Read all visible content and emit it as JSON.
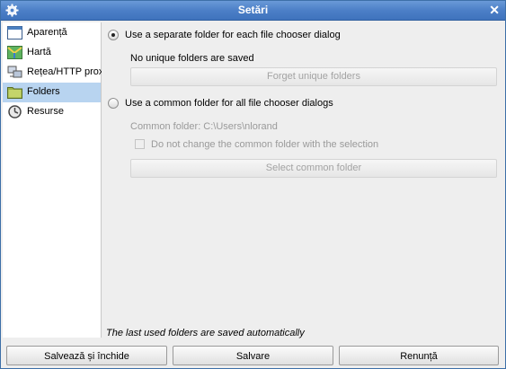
{
  "window": {
    "title": "Setări"
  },
  "sidebar": {
    "items": [
      {
        "label": "Aparență",
        "icon": "appearance-window-icon",
        "selected": false
      },
      {
        "label": "Hartă",
        "icon": "map-icon",
        "selected": false
      },
      {
        "label": "Rețea/HTTP proxy",
        "icon": "network-icon",
        "selected": false
      },
      {
        "label": "Folders",
        "icon": "folder-icon",
        "selected": true
      },
      {
        "label": "Resurse",
        "icon": "resources-icon",
        "selected": false
      }
    ]
  },
  "folders": {
    "option_separate": {
      "label": "Use a separate folder for each file chooser dialog",
      "checked": true
    },
    "no_unique_text": "No unique folders are saved",
    "forget_button": "Forget unique folders",
    "option_common": {
      "label": "Use a common folder for all file chooser dialogs",
      "checked": false
    },
    "common_folder_text": "Common folder: C:\\Users\\nlorand",
    "dont_change_checkbox": {
      "label": "Do not change the common folder with the selection",
      "checked": false
    },
    "select_common_button": "Select common folder",
    "note": "The last used folders are saved automatically"
  },
  "buttons": {
    "save_close": "Salvează și închide",
    "save": "Salvare",
    "cancel": "Renunță"
  },
  "colors": {
    "titlebar": "#4c7fc7",
    "selected_item": "#b8d4f0"
  }
}
